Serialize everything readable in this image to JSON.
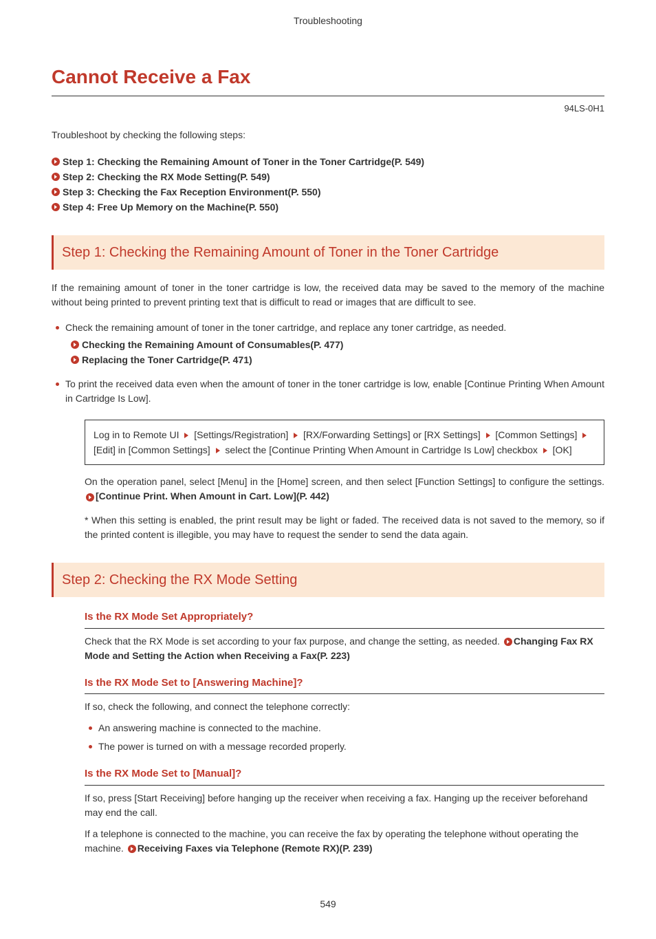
{
  "header": {
    "chapter": "Troubleshooting"
  },
  "title": "Cannot Receive a Fax",
  "doc_id": "94LS-0H1",
  "intro": "Troubleshoot by checking the following steps:",
  "toc": [
    {
      "label": "Step 1: Checking the Remaining Amount of Toner in the Toner Cartridge(P. 549)"
    },
    {
      "label": "Step 2: Checking the RX Mode Setting(P. 549)"
    },
    {
      "label": "Step 3: Checking the Fax Reception Environment(P. 550)"
    },
    {
      "label": "Step 4: Free Up Memory on the Machine(P. 550)"
    }
  ],
  "step1": {
    "heading": "Step 1: Checking the Remaining Amount of Toner in the Toner Cartridge",
    "intro": "If the remaining amount of toner in the toner cartridge is low, the received data may be saved to the memory of the machine without being printed to prevent printing text that is difficult to read or images that are difficult to see.",
    "bullet1": "Check the remaining amount of toner in the toner cartridge, and replace any toner cartridge, as needed.",
    "link1": "Checking the Remaining Amount of Consumables(P. 477)",
    "link2": "Replacing the Toner Cartridge(P. 471)",
    "bullet2": "To print the received data even when the amount of toner in the toner cartridge is low, enable [Continue Printing When Amount in Cartridge Is Low].",
    "box": {
      "p1": "Log in to Remote UI",
      "p2": "[Settings/Registration]",
      "p3": "[RX/Forwarding Settings] or [RX Settings]",
      "p4": "[Common Settings]",
      "p5": "[Edit] in [Common Settings]",
      "p6": "select the [Continue Printing When Amount in Cartridge Is Low] checkbox",
      "p7": "[OK]"
    },
    "panel_text_a": "On the operation panel, select [Menu] in the [Home] screen, and then select [Function Settings] to configure the settings. ",
    "panel_link": "[Continue Print. When Amount in Cart. Low](P. 442)",
    "note": "* When this setting is enabled, the print result may be light or faded. The received data is not saved to the memory, so if the printed content is illegible, you may have to request the sender to send the data again."
  },
  "step2": {
    "heading": "Step 2: Checking the RX Mode Setting",
    "q1": {
      "title": "Is the RX Mode Set Appropriately?",
      "text_a": "Check that the RX Mode is set according to your fax purpose, and change the setting, as needed. ",
      "link": "Changing Fax RX Mode and Setting the Action when Receiving a Fax(P. 223)"
    },
    "q2": {
      "title": "Is the RX Mode Set to [Answering Machine]?",
      "text": "If so, check the following, and connect the telephone correctly:",
      "b1": "An answering machine is connected to the machine.",
      "b2": "The power is turned on with a message recorded properly."
    },
    "q3": {
      "title": "Is the RX Mode Set to [Manual]?",
      "text1": "If so, press [Start Receiving] before hanging up the receiver when receiving a fax. Hanging up the receiver beforehand may end the call.",
      "text2": "If a telephone is connected to the machine, you can receive the fax by operating the telephone without operating the machine. ",
      "link": "Receiving Faxes via Telephone (Remote RX)(P. 239)"
    }
  },
  "page_number": "549"
}
